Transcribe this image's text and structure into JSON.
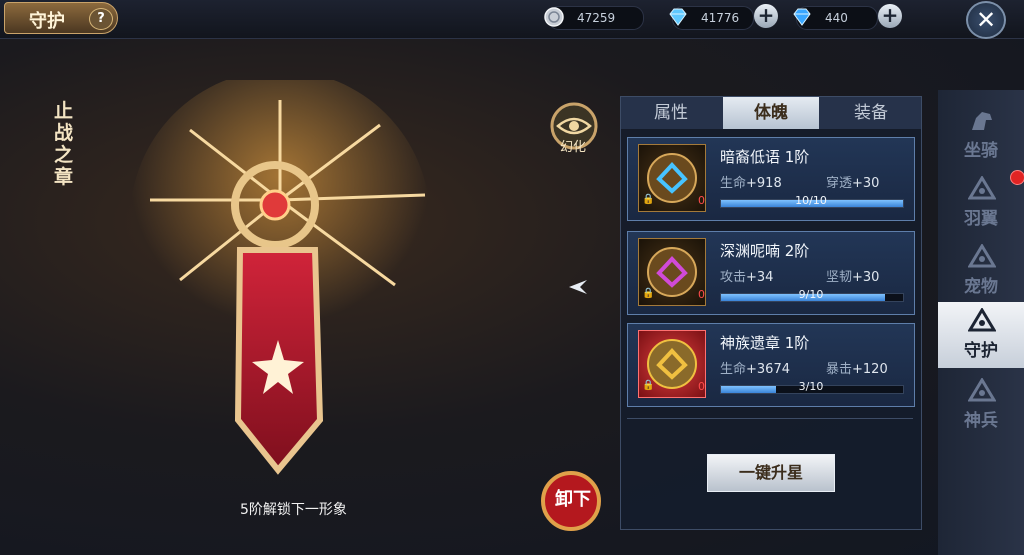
{
  "header": {
    "title": "守护",
    "help_label": "?",
    "close_label": "✕",
    "currencies": [
      {
        "icon": "silver-coin-icon",
        "value": "47259"
      },
      {
        "icon": "diamond-icon",
        "value": "41776"
      },
      {
        "icon": "bound-diamond-icon",
        "value": "440"
      }
    ],
    "plus_label": "+"
  },
  "showcase": {
    "caption": "止战之章",
    "unlock_hint": "5阶解锁下一形象",
    "huanhua_label": "幻化",
    "unequip_label": "卸下"
  },
  "tabs": [
    {
      "label": "属性",
      "active": false
    },
    {
      "label": "体魄",
      "active": true
    },
    {
      "label": "装备",
      "active": false
    }
  ],
  "cards": [
    {
      "name": "暗裔低语 1阶",
      "stat1_key": "生命",
      "stat1_val": "+918",
      "stat2_key": "穿透",
      "stat2_val": "+30",
      "progress_text": "10/10",
      "progress": 1.0,
      "lock": "🔒",
      "count": "0",
      "gem_color": "#47c4ff"
    },
    {
      "name": "深渊呢喃 2阶",
      "stat1_key": "攻击",
      "stat1_val": "+34",
      "stat2_key": "坚韧",
      "stat2_val": "+30",
      "progress_text": "9/10",
      "progress": 0.9,
      "lock": "🔒",
      "count": "0",
      "gem_color": "#d14ad8"
    },
    {
      "name": "神族遗章 1阶",
      "stat1_key": "生命",
      "stat1_val": "+3674",
      "stat2_key": "暴击",
      "stat2_val": "+120",
      "progress_text": "3/10",
      "progress": 0.3,
      "lock": "🔒",
      "count": "0",
      "gem_color": "#f0c040"
    }
  ],
  "upgrade_label": "一键升星",
  "sidenav": [
    {
      "label": "坐骑",
      "icon": "horse-icon",
      "active": false
    },
    {
      "label": "羽翼",
      "icon": "triangle-eye-icon",
      "active": false
    },
    {
      "label": "宠物",
      "icon": "triangle-eye-icon",
      "active": false
    },
    {
      "label": "守护",
      "icon": "triangle-eye-icon",
      "active": true
    },
    {
      "label": "神兵",
      "icon": "triangle-eye-icon",
      "active": false
    }
  ],
  "colors": {
    "accent": "#5e7eaa",
    "gold": "#c9a36a",
    "alert": "#e02424"
  }
}
